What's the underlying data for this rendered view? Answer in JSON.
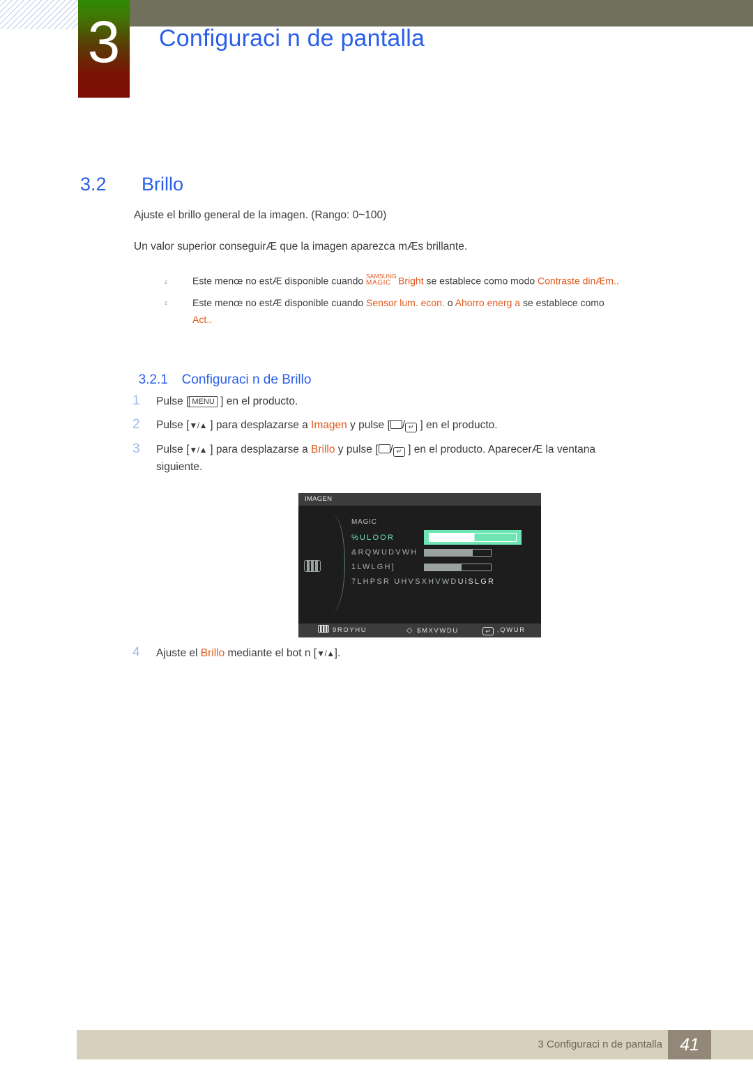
{
  "header": {
    "chapter_number": "3",
    "chapter_title": "Configuraci n de pantalla"
  },
  "section": {
    "number": "3.2",
    "title": "Brillo"
  },
  "body": {
    "paragraph_1": "Ajuste el brillo general de la imagen. (Rango: 0~100)",
    "paragraph_2": "Un valor superior conseguirÆ que la imagen aparezca mÆs brillante."
  },
  "notes": [
    {
      "bullet": "z",
      "text_before": "Este menœ no estÆ disponible cuando ",
      "magic_top": "SAMSUNG",
      "magic_bottom": "MAGIC",
      "keyword_1": "Bright",
      "text_middle": " se establece como modo ",
      "keyword_2": "Contraste dinÆm.."
    },
    {
      "bullet": "z",
      "text_before": "Este menœ no estÆ disponible cuando ",
      "keyword_1": "Sensor lum. econ.",
      "text_middle": " o ",
      "keyword_2": "Ahorro energ a",
      "text_after": " se establece como",
      "continuation": "Act.."
    }
  ],
  "subsection": {
    "number": "3.2.1",
    "title": "Configuraci n de Brillo"
  },
  "steps": [
    {
      "number": "1",
      "prefix": "Pulse [",
      "keycap": "MENU",
      "suffix": " ] en el producto."
    },
    {
      "number": "2",
      "prefix": "Pulse [",
      "arrows": "▼/▲",
      "mid": " ] para desplazarse a ",
      "keyword": "Imagen",
      "mid2": " y pulse [",
      "sep": "/",
      "suffix": " ] en el producto."
    },
    {
      "number": "3",
      "prefix": "Pulse [",
      "arrows": "▼/▲",
      "mid": " ] para desplazarse a ",
      "keyword": "Brillo",
      "mid2": " y pulse [",
      "sep": "/",
      "suffix": " ] en el producto. AparecerÆ la ventana",
      "continuation": "siguiente."
    },
    {
      "number": "4",
      "prefix": "Ajuste el ",
      "keyword": "Brillo",
      "mid": " mediante el bot n [",
      "arrows": "▼/▲",
      "suffix": "]."
    }
  ],
  "osd": {
    "title": "IMAGEN",
    "magic_label": "MAGIC",
    "rows": [
      {
        "label": "%ULOOR",
        "bar_fill_percent": 52,
        "highlighted": true
      },
      {
        "label": "&RQWUDVWH",
        "bar_fill_percent": 73,
        "highlighted": false
      },
      {
        "label": "1LWLGH]",
        "bar_fill_percent": 56,
        "highlighted": false
      },
      {
        "label": "7LHPSR UHVSXHVWD",
        "value": "UiSLGR",
        "highlighted": false
      }
    ],
    "footer": {
      "back": "9ROYHU",
      "adjust": "$MXVWDU",
      "enter": ",QWUR"
    },
    "accent_color": "#6ee6b4"
  },
  "page_footer": {
    "text": "3 Configuraci n de pantalla",
    "page_number": "41"
  }
}
